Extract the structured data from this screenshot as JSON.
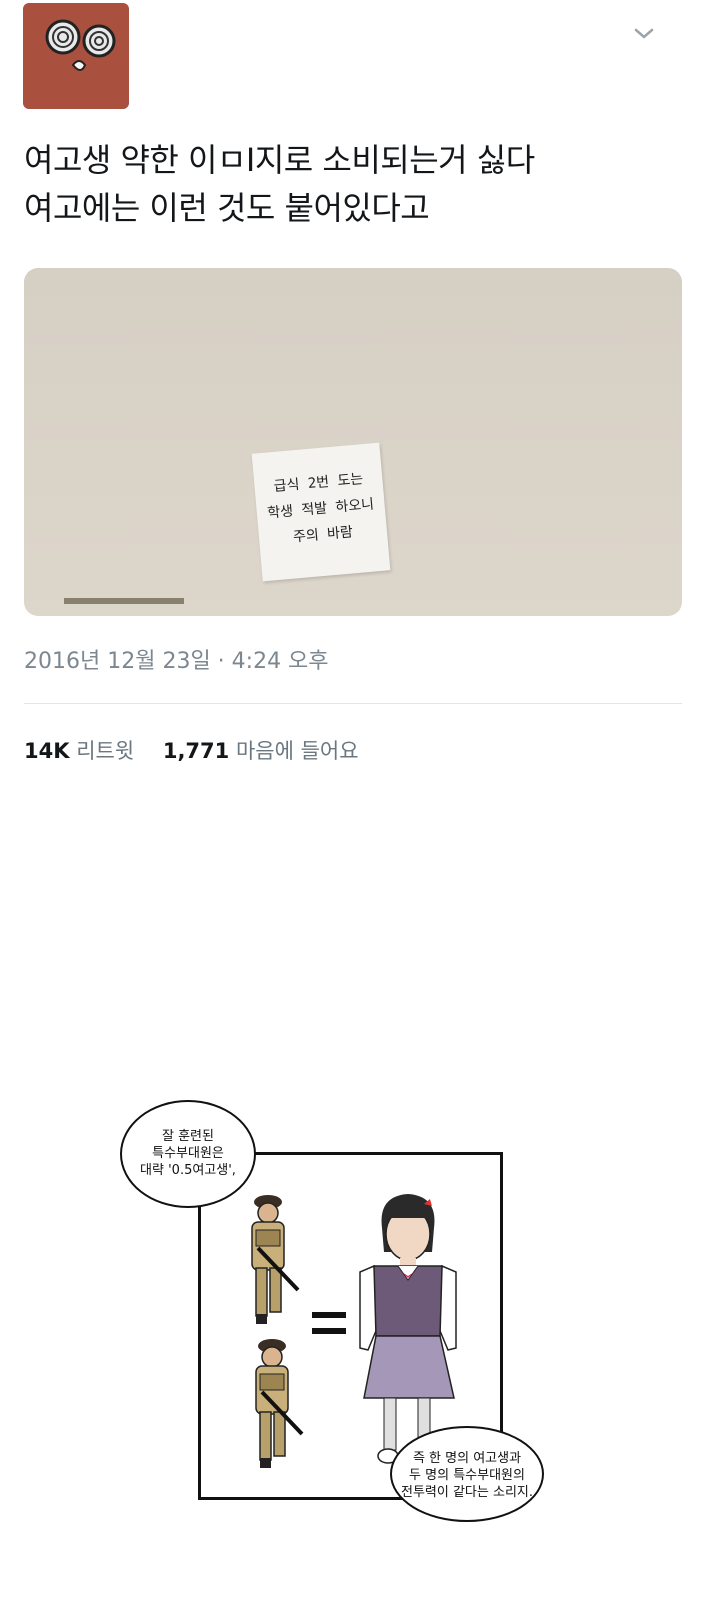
{
  "tweet": {
    "lines": [
      "여고생 약한 이ㅁI지로 소비되는거 싫다",
      "여고에는 이런 것도 붙어있다고"
    ],
    "photo_notice": [
      "급식 2번 도는",
      "학생 적발 하오니",
      "주의 바람"
    ],
    "timestamp": "2016년 12월 23일 · 4:24 오후",
    "retweets": {
      "count": "14K",
      "label": "리트윗"
    },
    "likes": {
      "count": "1,771",
      "label": "마음에 들어요"
    }
  },
  "comic": {
    "bubble_top": [
      "잘 훈련된",
      "특수부대원은",
      "대략 '0.5여고생',"
    ],
    "bubble_bottom": [
      "즉 한 명의 여고생과",
      "두 명의 특수부대원의",
      "전투력이 같다는 소리지."
    ]
  },
  "colors": {
    "avatar_bg": "#a9503f",
    "muted": "#7c8790"
  },
  "icons": {
    "menu": "chevron-down-icon"
  }
}
